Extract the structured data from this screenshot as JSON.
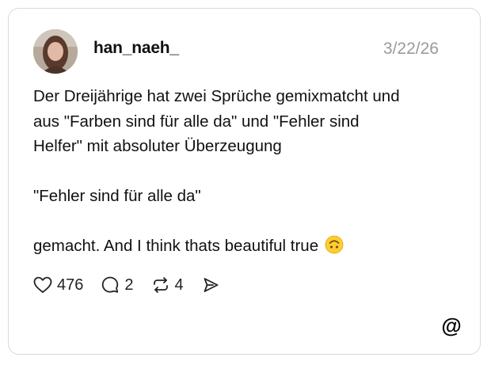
{
  "post": {
    "username": "han_naeh_",
    "date": "3/22/26",
    "lines": [
      "Der Dreijährige hat zwei Sprüche gemixmatcht und",
      "aus \"Farben sind für alle da\" und \"Fehler sind",
      "Helfer\" mit absoluter Überzeugung"
    ],
    "quote": "\"Fehler sind für alle da\"",
    "closing": "gemacht. And I think thats beautiful true",
    "emoji": "upside-down-face-emoji"
  },
  "actions": {
    "likes": "476",
    "replies": "2",
    "reposts": "4",
    "like_icon": "heart-icon",
    "reply_icon": "speech-bubble-icon",
    "repost_icon": "repost-icon",
    "share_icon": "send-icon"
  },
  "brand": {
    "logo_icon": "threads-logo-icon"
  }
}
